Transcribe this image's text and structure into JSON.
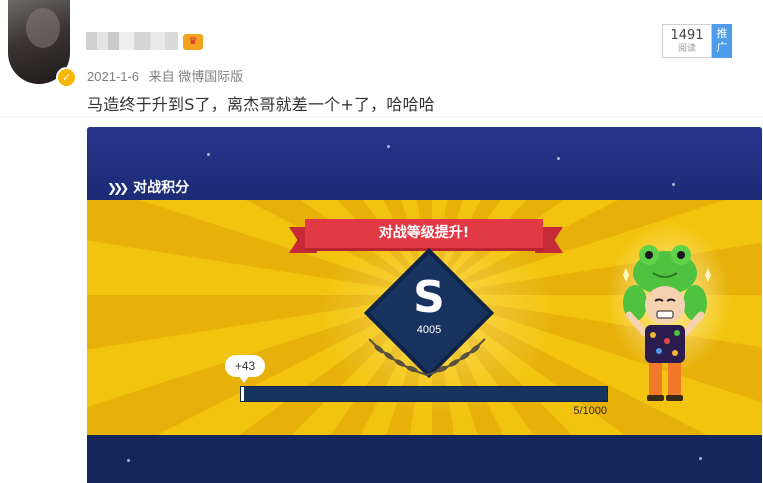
{
  "post": {
    "date": "2021-1-6",
    "source": "来自 微博国际版",
    "text": "马造终于升到S了，离杰哥就差一个+了，哈哈哈",
    "read_count": "1491",
    "read_label": "阅读",
    "promote_label": "推广"
  },
  "game": {
    "section_title": "对战积分",
    "banner": "对战等级提升!",
    "rank": "S",
    "score": "4005",
    "gain": "+43",
    "progress": {
      "current": 5,
      "max": 1000,
      "label": "5/1000",
      "fraction": 0.005
    }
  },
  "colors": {
    "verified": "#f8b600",
    "promo": "#4d9ceb",
    "banner_red": "#e23a45",
    "game_yellow": "#f3c40f",
    "game_navy": "#1b2e6a"
  },
  "icons": [
    "avatar",
    "verified-badge-icon",
    "vip-crown-icon",
    "chevron-double-right-icon",
    "laurel-icon"
  ]
}
